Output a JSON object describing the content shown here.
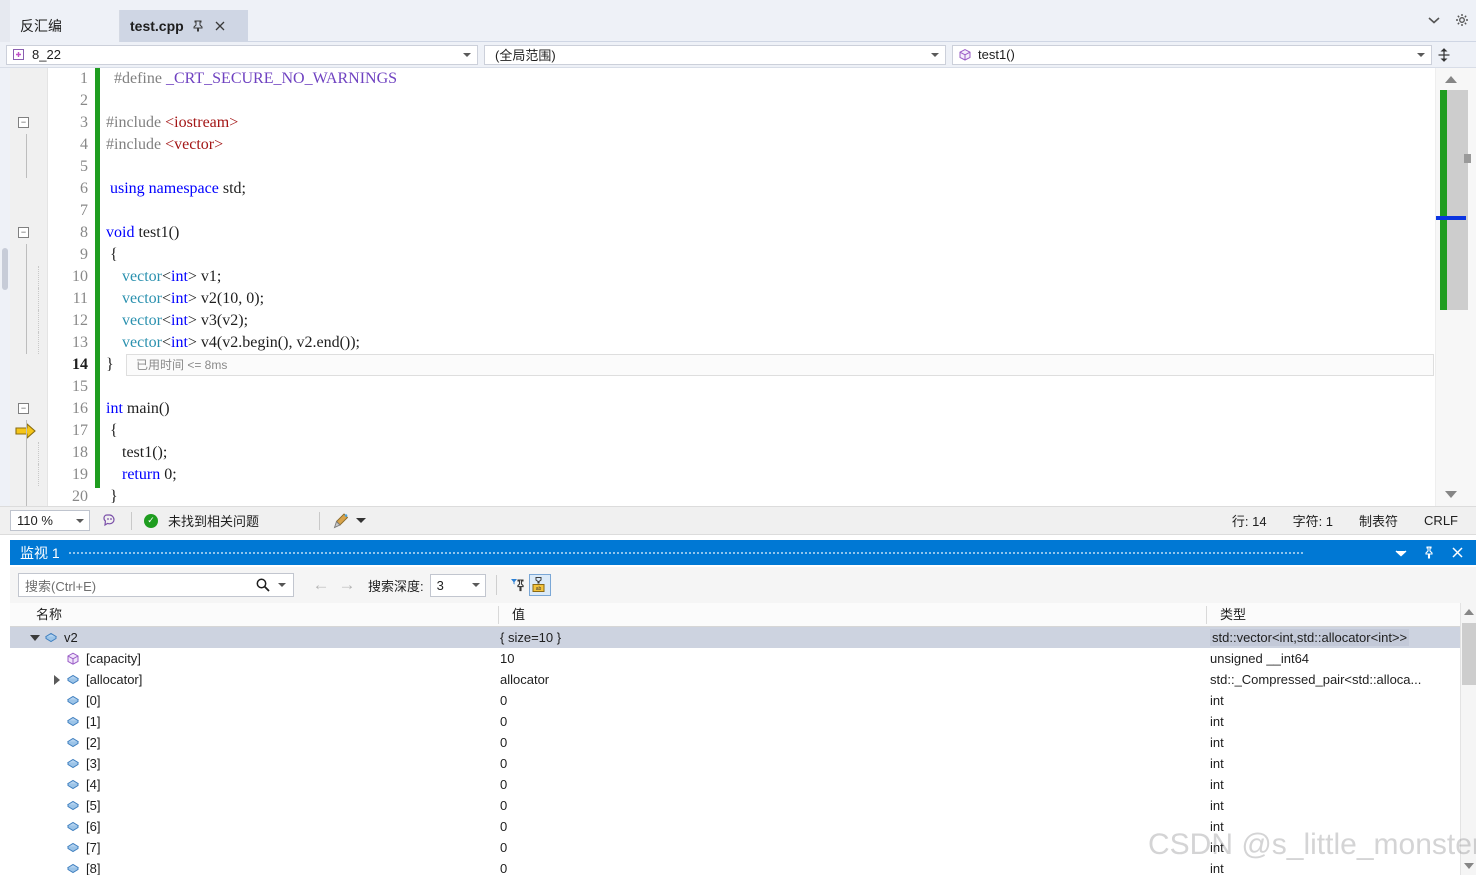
{
  "window": {
    "tabs": [
      {
        "label": "反汇编",
        "active": false
      },
      {
        "label": "test.cpp",
        "active": true
      }
    ],
    "tab_pin_icon": "pin-icon",
    "tab_close_icon": "close-icon",
    "chevron_icon": "chevron-down-icon",
    "gear_icon": "gear-icon"
  },
  "navbar": {
    "scope_value": "8_22",
    "scope_icon": "project-icon",
    "global_value": "(全局范围)",
    "function_value": "test1()",
    "function_icon": "method-cube-icon",
    "split_icon": "split-view-icon"
  },
  "editor": {
    "exec_arrow_icon": "execution-pointer-icon",
    "lines": [
      {
        "num": "1",
        "current": false,
        "fold": "",
        "indent": 0,
        "tokens": [
          {
            "t": "  #define ",
            "c": "k-pp"
          },
          {
            "t": "_CRT_SECURE_NO_WARNINGS",
            "c": "k-ppid"
          }
        ]
      },
      {
        "num": "2",
        "current": false,
        "fold": "",
        "indent": 0,
        "tokens": []
      },
      {
        "num": "3",
        "current": false,
        "fold": "-",
        "indent": 0,
        "tokens": [
          {
            "t": "#include ",
            "c": "k-pp"
          },
          {
            "t": "<iostream>",
            "c": "k-inc"
          }
        ]
      },
      {
        "num": "4",
        "current": false,
        "fold": "",
        "indent": 0,
        "tokens": [
          {
            "t": "#include ",
            "c": "k-pp"
          },
          {
            "t": "<vector>",
            "c": "k-inc"
          }
        ]
      },
      {
        "num": "5",
        "current": false,
        "fold": "",
        "indent": 0,
        "tokens": []
      },
      {
        "num": "6",
        "current": false,
        "fold": "",
        "indent": 0,
        "tokens": [
          {
            "t": " using namespace ",
            "c": "k-kw"
          },
          {
            "t": "std;",
            "c": "k-id"
          }
        ]
      },
      {
        "num": "7",
        "current": false,
        "fold": "",
        "indent": 0,
        "tokens": []
      },
      {
        "num": "8",
        "current": false,
        "fold": "-",
        "indent": 0,
        "tokens": [
          {
            "t": "void ",
            "c": "k-kw"
          },
          {
            "t": "test1()",
            "c": "k-id"
          }
        ]
      },
      {
        "num": "9",
        "current": false,
        "fold": "",
        "indent": 0,
        "tokens": [
          {
            "t": " {",
            "c": "k-id"
          }
        ]
      },
      {
        "num": "10",
        "current": false,
        "fold": "",
        "indent": 1,
        "tokens": [
          {
            "t": "    ",
            "c": "k-id"
          },
          {
            "t": "vector",
            "c": "k-type"
          },
          {
            "t": "<",
            "c": "k-id"
          },
          {
            "t": "int",
            "c": "k-kw"
          },
          {
            "t": "> v1;",
            "c": "k-id"
          }
        ]
      },
      {
        "num": "11",
        "current": false,
        "fold": "",
        "indent": 1,
        "tokens": [
          {
            "t": "    ",
            "c": "k-id"
          },
          {
            "t": "vector",
            "c": "k-type"
          },
          {
            "t": "<",
            "c": "k-id"
          },
          {
            "t": "int",
            "c": "k-kw"
          },
          {
            "t": "> v2(",
            "c": "k-id"
          },
          {
            "t": "10",
            "c": "k-num"
          },
          {
            "t": ", ",
            "c": "k-id"
          },
          {
            "t": "0",
            "c": "k-num"
          },
          {
            "t": ");",
            "c": "k-id"
          }
        ]
      },
      {
        "num": "12",
        "current": false,
        "fold": "",
        "indent": 1,
        "tokens": [
          {
            "t": "    ",
            "c": "k-id"
          },
          {
            "t": "vector",
            "c": "k-type"
          },
          {
            "t": "<",
            "c": "k-id"
          },
          {
            "t": "int",
            "c": "k-kw"
          },
          {
            "t": "> v3(v2);",
            "c": "k-id"
          }
        ]
      },
      {
        "num": "13",
        "current": false,
        "fold": "",
        "indent": 1,
        "tokens": [
          {
            "t": "    ",
            "c": "k-id"
          },
          {
            "t": "vector",
            "c": "k-type"
          },
          {
            "t": "<",
            "c": "k-id"
          },
          {
            "t": "int",
            "c": "k-kw"
          },
          {
            "t": "> v4(v2.begin(), v2.end());",
            "c": "k-id"
          }
        ]
      },
      {
        "num": "14",
        "current": true,
        "fold": "",
        "indent": 0,
        "tokens": [
          {
            "t": "}",
            "c": "k-id"
          }
        ],
        "diagnostic": "已用时间 <= 8ms"
      },
      {
        "num": "15",
        "current": false,
        "fold": "",
        "indent": 0,
        "tokens": []
      },
      {
        "num": "16",
        "current": false,
        "fold": "-",
        "indent": 0,
        "tokens": [
          {
            "t": "int ",
            "c": "k-kw"
          },
          {
            "t": "main()",
            "c": "k-id"
          }
        ]
      },
      {
        "num": "17",
        "current": false,
        "fold": "",
        "indent": 0,
        "tokens": [
          {
            "t": " {",
            "c": "k-id"
          }
        ]
      },
      {
        "num": "18",
        "current": false,
        "fold": "",
        "indent": 1,
        "tokens": [
          {
            "t": "    test1();",
            "c": "k-id"
          }
        ]
      },
      {
        "num": "19",
        "current": false,
        "fold": "",
        "indent": 1,
        "tokens": [
          {
            "t": "    ",
            "c": "k-id"
          },
          {
            "t": "return ",
            "c": "k-kw"
          },
          {
            "t": "0",
            "c": "k-num"
          },
          {
            "t": ";",
            "c": "k-id"
          }
        ]
      },
      {
        "num": "20",
        "current": false,
        "fold": "",
        "indent": 0,
        "tokens": [
          {
            "t": " }",
            "c": "k-id"
          }
        ]
      }
    ]
  },
  "editor_status": {
    "zoom": "110 %",
    "intellisense_icon": "intellisense-icon",
    "problem_status": "未找到相关问题",
    "broom_icon": "code-cleanup-icon",
    "line_label": "行: 14",
    "char_label": "字符: 1",
    "tab_label": "制表符",
    "eol_label": "CRLF"
  },
  "watch": {
    "title": "监视 1",
    "titlebar_icons": {
      "chevron": "chevron-down-icon",
      "pin": "pin-icon",
      "close": "close-icon"
    },
    "toolbar": {
      "search_placeholder": "搜索(Ctrl+E)",
      "search_value": "",
      "search_icon": "search-icon",
      "back_icon": "arrow-left-icon",
      "forward_icon": "arrow-right-icon",
      "depth_label": "搜索深度:",
      "depth_value": "3",
      "pin_filter_icon": "pin-filter-icon",
      "hex_icon": "hex-display-icon"
    },
    "columns": [
      "名称",
      "值",
      "类型"
    ],
    "rows": [
      {
        "indent": 0,
        "expander": "down",
        "icon": "object-icon",
        "name": "v2",
        "value": "{ size=10 }",
        "type": "std::vector<int,std::allocator<int>>",
        "selected": true
      },
      {
        "indent": 1,
        "expander": "none",
        "icon": "property-icon",
        "name": "[capacity]",
        "value": "10",
        "type": "unsigned __int64",
        "selected": false
      },
      {
        "indent": 1,
        "expander": "right",
        "icon": "object-icon",
        "name": "[allocator]",
        "value": "allocator",
        "type": "std::_Compressed_pair<std::alloca...",
        "selected": false
      },
      {
        "indent": 1,
        "expander": "none",
        "icon": "object-icon",
        "name": "[0]",
        "value": "0",
        "type": "int",
        "selected": false
      },
      {
        "indent": 1,
        "expander": "none",
        "icon": "object-icon",
        "name": "[1]",
        "value": "0",
        "type": "int",
        "selected": false
      },
      {
        "indent": 1,
        "expander": "none",
        "icon": "object-icon",
        "name": "[2]",
        "value": "0",
        "type": "int",
        "selected": false
      },
      {
        "indent": 1,
        "expander": "none",
        "icon": "object-icon",
        "name": "[3]",
        "value": "0",
        "type": "int",
        "selected": false
      },
      {
        "indent": 1,
        "expander": "none",
        "icon": "object-icon",
        "name": "[4]",
        "value": "0",
        "type": "int",
        "selected": false
      },
      {
        "indent": 1,
        "expander": "none",
        "icon": "object-icon",
        "name": "[5]",
        "value": "0",
        "type": "int",
        "selected": false
      },
      {
        "indent": 1,
        "expander": "none",
        "icon": "object-icon",
        "name": "[6]",
        "value": "0",
        "type": "int",
        "selected": false
      },
      {
        "indent": 1,
        "expander": "none",
        "icon": "object-icon",
        "name": "[7]",
        "value": "0",
        "type": "int",
        "selected": false
      },
      {
        "indent": 1,
        "expander": "none",
        "icon": "object-icon",
        "name": "[8]",
        "value": "0",
        "type": "int",
        "selected": false
      }
    ]
  },
  "watermark": "CSDN @s_little_monster",
  "colors": {
    "accent_blue": "#0078d4",
    "selection": "#cdd3e0",
    "change_bar_green": "#1f9d20",
    "exec_arrow": "#f0c419",
    "keyword": "#0000ff",
    "type": "#2b91af",
    "string": "#a31515",
    "macro": "#6f42c1"
  }
}
